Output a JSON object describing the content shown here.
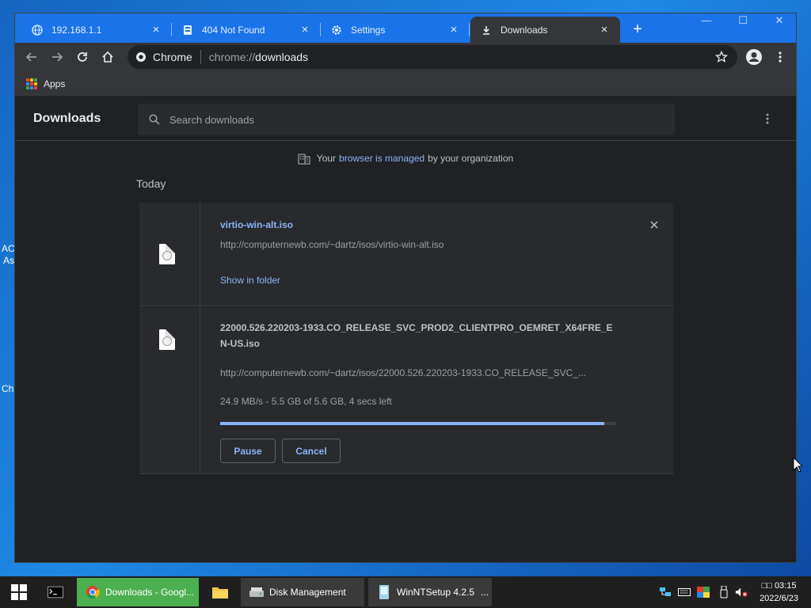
{
  "desktop": {
    "left_text_1": "AC",
    "left_text_2": "As",
    "left_text_3": "Ch"
  },
  "tabs": [
    {
      "label": "192.168.1.1",
      "icon": "globe-icon"
    },
    {
      "label": "404 Not Found",
      "icon": "server-icon"
    },
    {
      "label": "Settings",
      "icon": "gear-icon"
    },
    {
      "label": "Downloads",
      "icon": "download-icon"
    }
  ],
  "omnibox": {
    "chip": "Chrome",
    "scheme": "chrome://",
    "host": "downloads"
  },
  "bookmarks": {
    "apps_label": "Apps"
  },
  "downloads": {
    "title": "Downloads",
    "search_placeholder": "Search downloads",
    "managed": {
      "prefix": "Your",
      "link": "browser is managed",
      "suffix": "by your organization"
    },
    "section": "Today",
    "items": [
      {
        "filename": "virtio-win-alt.iso",
        "url": "http://computernewb.com/~dartz/isos/virtio-win-alt.iso",
        "action": "Show in folder"
      },
      {
        "filename": "22000.526.220203-1933.CO_RELEASE_SVC_PROD2_CLIENTPRO_OEMRET_X64FRE_EN-US.iso",
        "url": "http://computernewb.com/~dartz/isos/22000.526.220203-1933.CO_RELEASE_SVC_...",
        "status": "24.9 MB/s - 5.5 GB of 5.6 GB, 4 secs left",
        "progress": 0.97,
        "pause_label": "Pause",
        "cancel_label": "Cancel"
      }
    ]
  },
  "taskbar": {
    "items": [
      {
        "label": "Downloads - Googl..."
      },
      {
        "label": "Disk Management"
      },
      {
        "label": "WinNTSetup 4.2.5"
      }
    ],
    "overflow": "...",
    "clock_time": "□□ 03:15",
    "clock_date": "2022/6/23"
  },
  "colors": {
    "accent": "#1a73e8",
    "link": "#8ab4f8",
    "bg": "#202124",
    "card": "#292a2d",
    "taskbar_active": "#4caf50"
  }
}
